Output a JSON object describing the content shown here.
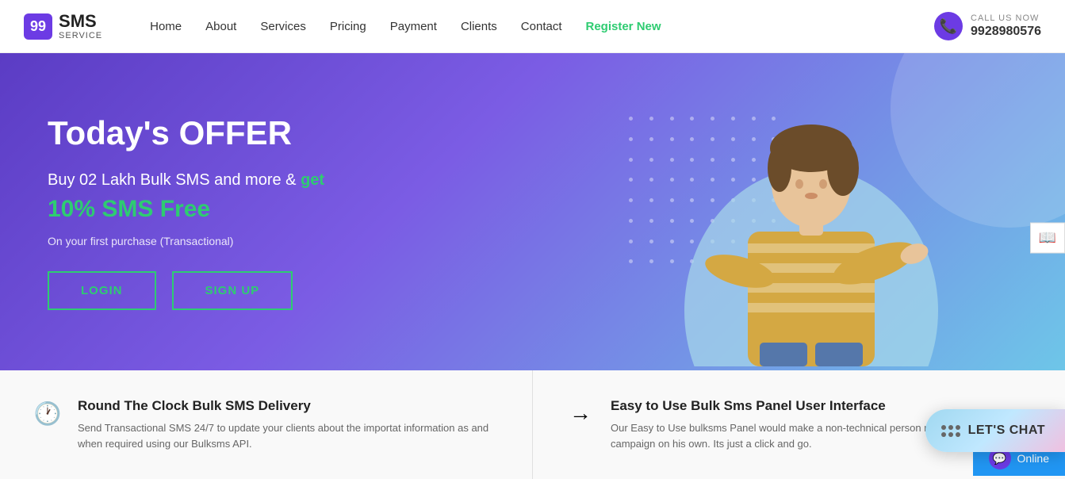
{
  "header": {
    "logo_badge": "99",
    "logo_sms": "SMS",
    "logo_service": "SERVICE",
    "call_label": "CALL US NOW",
    "call_number": "9928980576",
    "nav_items": [
      {
        "label": "Home",
        "href": "#",
        "class": ""
      },
      {
        "label": "About",
        "href": "#",
        "class": ""
      },
      {
        "label": "Services",
        "href": "#",
        "class": ""
      },
      {
        "label": "Pricing",
        "href": "#",
        "class": ""
      },
      {
        "label": "Payment",
        "href": "#",
        "class": ""
      },
      {
        "label": "Clients",
        "href": "#",
        "class": ""
      },
      {
        "label": "Contact",
        "href": "#",
        "class": ""
      },
      {
        "label": "Register New",
        "href": "#",
        "class": "register"
      }
    ]
  },
  "hero": {
    "title": "Today's OFFER",
    "line1": "Buy 02 Lakh Bulk SMS and more & ",
    "highlight": "get",
    "free_line": "10% SMS Free",
    "note": "On your first purchase (Transactional)",
    "login_btn": "LOGIN",
    "signup_btn": "SIGN UP"
  },
  "features": [
    {
      "icon": "🕐",
      "title": "Round The Clock Bulk SMS Delivery",
      "description": "Send Transactional SMS 24/7 to update your clients about the importat information as and when required using our Bulksms API."
    },
    {
      "icon": "→",
      "title": "Easy to Use Bulk Sms Panel User Interface",
      "description": "Our Easy to Use bulksms Panel would make a non-technical person manage their Bulk sms campaign on his own. Its just a click and go."
    }
  ],
  "chat": {
    "label": "LET'S CHAT",
    "online": "Online"
  }
}
